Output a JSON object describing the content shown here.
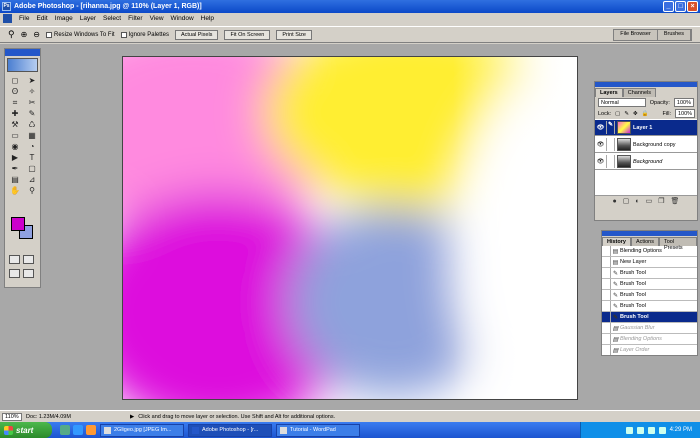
{
  "window": {
    "title": "Adobe Photoshop - [rihanna.jpg @ 110% (Layer 1, RGB)]",
    "buttons": [
      "_",
      "□",
      "×"
    ]
  },
  "menu": [
    "File",
    "Edit",
    "Image",
    "Layer",
    "Select",
    "Filter",
    "View",
    "Window",
    "Help"
  ],
  "options_bar": {
    "zoom_in": "⊕",
    "zoom_out": "⊖",
    "resize_windows": "Resize Windows To Fit",
    "ignore_palettes": "Ignore Palettes",
    "actual_pixels": "Actual Pixels",
    "fit_on_screen": "Fit On Screen",
    "print_size": "Print Size"
  },
  "palette_well": [
    "File Browser",
    "Brushes"
  ],
  "toolbox": {
    "tools": [
      "marquee",
      "move",
      "lasso",
      "magic-wand",
      "crop",
      "slice",
      "healing",
      "brush",
      "stamp",
      "history-brush",
      "eraser",
      "gradient",
      "blur",
      "dodge",
      "path-select",
      "type",
      "pen",
      "shape",
      "notes",
      "eyedropper",
      "hand",
      "zoom"
    ],
    "tool_glyphs": [
      "◻",
      "➤",
      "ʘ",
      "✧",
      "⌗",
      "✂",
      "✚",
      "✎",
      "⚒",
      "♺",
      "▭",
      "▦",
      "◉",
      "◔",
      "▶",
      "T",
      "✒",
      "▢",
      "▤",
      "⊿",
      "✋",
      "⚲"
    ],
    "foreground_color": "#cc00cc",
    "background_color": "#8fa0e0"
  },
  "layers_panel": {
    "tabs": [
      "Layers",
      "Channels"
    ],
    "blend_mode": "Normal",
    "opacity_label": "Opacity:",
    "opacity_value": "100%",
    "lock_label": "Lock:",
    "fill_label": "Fill:",
    "fill_value": "100%",
    "layers": [
      {
        "name": "Layer 1",
        "selected": true
      },
      {
        "name": "Background copy",
        "selected": false
      },
      {
        "name": "Background",
        "selected": false
      }
    ],
    "footer_icons": [
      "●",
      "▢",
      "◐",
      "▭",
      "❐",
      "🗑"
    ]
  },
  "history_panel": {
    "tabs": [
      "History",
      "Actions",
      "Tool Presets"
    ],
    "items": [
      {
        "name": "Blending Options",
        "state": "normal"
      },
      {
        "name": "New Layer",
        "state": "normal"
      },
      {
        "name": "Brush Tool",
        "state": "normal"
      },
      {
        "name": "Brush Tool",
        "state": "normal"
      },
      {
        "name": "Brush Tool",
        "state": "normal"
      },
      {
        "name": "Brush Tool",
        "state": "normal"
      },
      {
        "name": "Brush Tool",
        "state": "selected"
      },
      {
        "name": "Gaussian Blur",
        "state": "undone"
      },
      {
        "name": "Blending Options",
        "state": "undone"
      },
      {
        "name": "Layer Order",
        "state": "undone"
      }
    ]
  },
  "status_bar": {
    "zoom": "110%",
    "doc": "Doc: 1.23M/4.09M",
    "hint": "Click and drag to move layer or selection.  Use Shift and Alt for additional options."
  },
  "taskbar": {
    "start": "start",
    "tasks": [
      {
        "label": "2Gligeo.jpg [JPEG Im...",
        "active": false
      },
      {
        "label": "Adobe Photoshop - [r...",
        "active": true
      },
      {
        "label": "Tutorial - WordPad",
        "active": false
      }
    ],
    "clock": "4:29 PM"
  },
  "canvas": {
    "colors": {
      "pink": "#ff88dd",
      "yellow": "#ffee33",
      "magenta": "#dd11dd",
      "blue": "#8ea2dc",
      "white": "#ffffff"
    }
  }
}
